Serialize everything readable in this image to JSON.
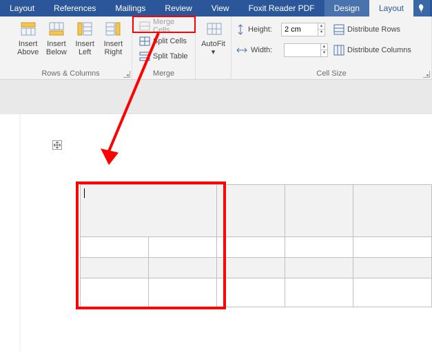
{
  "tabs": {
    "layout1": "Layout",
    "references": "References",
    "mailings": "Mailings",
    "review": "Review",
    "view": "View",
    "foxit": "Foxit Reader PDF",
    "design": "Design",
    "layout2": "Layout"
  },
  "rows_cols": {
    "group_label": "Rows & Columns",
    "insert_above": "Insert\nAbove",
    "insert_below": "Insert\nBelow",
    "insert_left": "Insert\nLeft",
    "insert_right": "Insert\nRight"
  },
  "merge": {
    "group_label": "Merge",
    "merge_cells": "Merge Cells",
    "split_cells": "Split Cells",
    "split_table": "Split Table"
  },
  "autofit": {
    "label": "AutoFit"
  },
  "cellsize": {
    "group_label": "Cell Size",
    "height_label": "Height:",
    "height_value": "2 cm",
    "width_label": "Width:",
    "width_value": "",
    "dist_rows": "Distribute Rows",
    "dist_cols": "Distribute Columns"
  },
  "colors": {
    "ribbon_blue": "#2b579a",
    "highlight": "#ff0000"
  },
  "table": {
    "cols": [
      100,
      100,
      100,
      100,
      115
    ],
    "row_heights": {
      "head": 76,
      "body": 30
    }
  }
}
